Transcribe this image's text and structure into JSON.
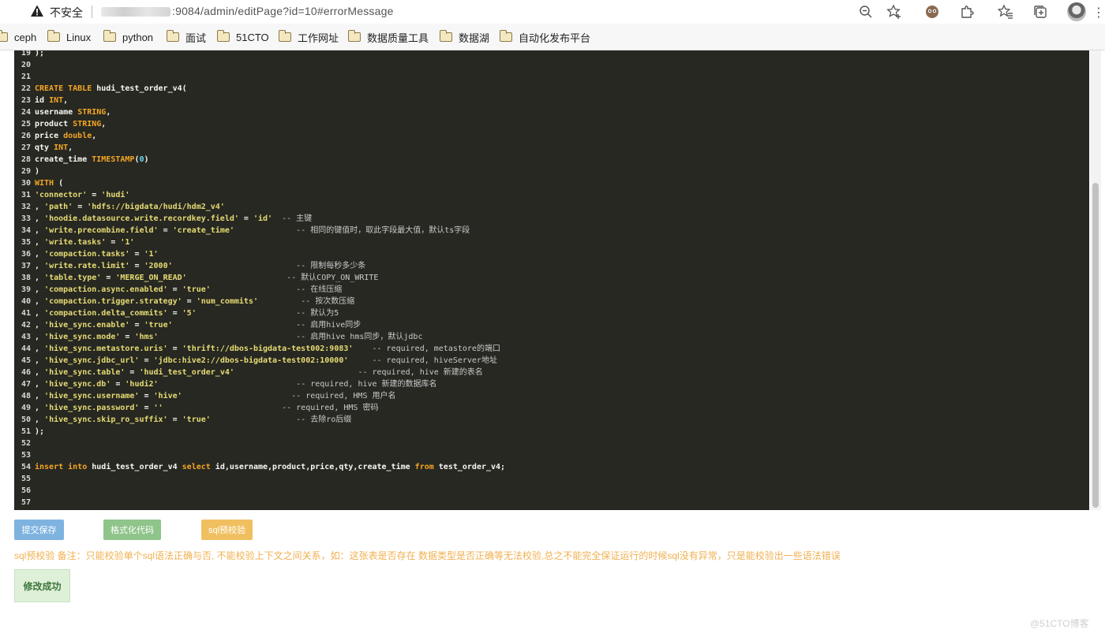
{
  "browser": {
    "security_label": "不安全",
    "url_visible": ":9084/admin/editPage?id=10#errorMessage"
  },
  "bookmarks": [
    "ceph",
    "Linux",
    "python",
    "面试",
    "51CTO",
    "工作网址",
    "数据质量工具",
    "数据湖",
    "自动化发布平台"
  ],
  "editor": {
    "lines": [
      {
        "n": "19",
        "segs": [
          [
            "t",
            ");"
          ]
        ]
      },
      {
        "n": "20",
        "segs": []
      },
      {
        "n": "21",
        "segs": []
      },
      {
        "n": "22",
        "segs": [
          [
            "k",
            "CREATE TABLE"
          ],
          [
            "t",
            " hudi_test_order_v4("
          ]
        ]
      },
      {
        "n": "23",
        "segs": [
          [
            "t",
            "id "
          ],
          [
            "k",
            "INT"
          ],
          [
            "t",
            ","
          ]
        ]
      },
      {
        "n": "24",
        "segs": [
          [
            "t",
            "username "
          ],
          [
            "k",
            "STRING"
          ],
          [
            "t",
            ","
          ]
        ]
      },
      {
        "n": "25",
        "segs": [
          [
            "t",
            "product "
          ],
          [
            "k",
            "STRING"
          ],
          [
            "t",
            ","
          ]
        ]
      },
      {
        "n": "26",
        "segs": [
          [
            "t",
            "price "
          ],
          [
            "k",
            "double"
          ],
          [
            "t",
            ","
          ]
        ]
      },
      {
        "n": "27",
        "segs": [
          [
            "t",
            "qty "
          ],
          [
            "k",
            "INT"
          ],
          [
            "t",
            ","
          ]
        ]
      },
      {
        "n": "28",
        "segs": [
          [
            "t",
            "create_time "
          ],
          [
            "k",
            "TIMESTAMP"
          ],
          [
            "t",
            "("
          ],
          [
            "n",
            "0"
          ],
          [
            "t",
            ")"
          ]
        ]
      },
      {
        "n": "29",
        "segs": [
          [
            "t",
            ")"
          ]
        ]
      },
      {
        "n": "30",
        "segs": [
          [
            "k",
            "WITH"
          ],
          [
            "t",
            " ("
          ]
        ]
      },
      {
        "n": "31",
        "segs": [
          [
            "s",
            "'connector'"
          ],
          [
            "t",
            " = "
          ],
          [
            "s",
            "'hudi'"
          ]
        ]
      },
      {
        "n": "32",
        "segs": [
          [
            "t",
            ", "
          ],
          [
            "s",
            "'path'"
          ],
          [
            "t",
            " = "
          ],
          [
            "s",
            "'hdfs://bigdata/hudi/hdm2_v4'"
          ]
        ]
      },
      {
        "n": "33",
        "segs": [
          [
            "t",
            ", "
          ],
          [
            "s",
            "'hoodie.datasource.write.recordkey.field'"
          ],
          [
            "t",
            " = "
          ],
          [
            "s",
            "'id'"
          ],
          [
            "t",
            "  "
          ],
          [
            "c",
            "-- 主键"
          ]
        ]
      },
      {
        "n": "34",
        "segs": [
          [
            "t",
            ", "
          ],
          [
            "s",
            "'write.precombine.field'"
          ],
          [
            "t",
            " = "
          ],
          [
            "s",
            "'create_time'"
          ],
          [
            "t",
            "             "
          ],
          [
            "c",
            "-- 相同的键值时，取此字段最大值，默认ts字段"
          ]
        ]
      },
      {
        "n": "35",
        "segs": [
          [
            "t",
            ", "
          ],
          [
            "s",
            "'write.tasks'"
          ],
          [
            "t",
            " = "
          ],
          [
            "s",
            "'1'"
          ]
        ]
      },
      {
        "n": "36",
        "segs": [
          [
            "t",
            ", "
          ],
          [
            "s",
            "'compaction.tasks'"
          ],
          [
            "t",
            " = "
          ],
          [
            "s",
            "'1'"
          ]
        ]
      },
      {
        "n": "37",
        "segs": [
          [
            "t",
            ", "
          ],
          [
            "s",
            "'write.rate.limit'"
          ],
          [
            "t",
            " = "
          ],
          [
            "s",
            "'2000'"
          ],
          [
            "t",
            "                          "
          ],
          [
            "c",
            "-- 限制每秒多少条"
          ]
        ]
      },
      {
        "n": "38",
        "segs": [
          [
            "t",
            ", "
          ],
          [
            "s",
            "'table.type'"
          ],
          [
            "t",
            " = "
          ],
          [
            "s",
            "'MERGE_ON_READ'"
          ],
          [
            "t",
            "                     "
          ],
          [
            "c",
            "-- 默认COPY_ON_WRITE"
          ]
        ]
      },
      {
        "n": "39",
        "segs": [
          [
            "t",
            ", "
          ],
          [
            "s",
            "'compaction.async.enabled'"
          ],
          [
            "t",
            " = "
          ],
          [
            "s",
            "'true'"
          ],
          [
            "t",
            "                  "
          ],
          [
            "c",
            "-- 在线压缩"
          ]
        ]
      },
      {
        "n": "40",
        "segs": [
          [
            "t",
            ", "
          ],
          [
            "s",
            "'compaction.trigger.strategy'"
          ],
          [
            "t",
            " = "
          ],
          [
            "s",
            "'num_commits'"
          ],
          [
            "t",
            "         "
          ],
          [
            "c",
            "-- 按次数压缩"
          ]
        ]
      },
      {
        "n": "41",
        "segs": [
          [
            "t",
            ", "
          ],
          [
            "s",
            "'compaction.delta_commits'"
          ],
          [
            "t",
            " = "
          ],
          [
            "s",
            "'5'"
          ],
          [
            "t",
            "                     "
          ],
          [
            "c",
            "-- 默认为5"
          ]
        ]
      },
      {
        "n": "42",
        "segs": [
          [
            "t",
            ", "
          ],
          [
            "s",
            "'hive_sync.enable'"
          ],
          [
            "t",
            " = "
          ],
          [
            "s",
            "'true'"
          ],
          [
            "t",
            "                          "
          ],
          [
            "c",
            "-- 启用hive同步"
          ]
        ]
      },
      {
        "n": "43",
        "segs": [
          [
            "t",
            ", "
          ],
          [
            "s",
            "'hive_sync.mode'"
          ],
          [
            "t",
            " = "
          ],
          [
            "s",
            "'hms'"
          ],
          [
            "t",
            "                             "
          ],
          [
            "c",
            "-- 启用hive hms同步，默认jdbc"
          ]
        ]
      },
      {
        "n": "44",
        "segs": [
          [
            "t",
            ", "
          ],
          [
            "s",
            "'hive_sync.metastore.uris'"
          ],
          [
            "t",
            " = "
          ],
          [
            "s",
            "'thrift://dbos-bigdata-test002:9083'"
          ],
          [
            "t",
            "    "
          ],
          [
            "c",
            "-- required, metastore的端口"
          ]
        ]
      },
      {
        "n": "45",
        "segs": [
          [
            "t",
            ", "
          ],
          [
            "s",
            "'hive_sync.jdbc_url'"
          ],
          [
            "t",
            " = "
          ],
          [
            "s",
            "'jdbc:hive2://dbos-bigdata-test002:10000'"
          ],
          [
            "t",
            "     "
          ],
          [
            "c",
            "-- required, hiveServer地址"
          ]
        ]
      },
      {
        "n": "46",
        "segs": [
          [
            "t",
            ", "
          ],
          [
            "s",
            "'hive_sync.table'"
          ],
          [
            "t",
            " = "
          ],
          [
            "s",
            "'hudi_test_order_v4'"
          ],
          [
            "t",
            "                          "
          ],
          [
            "c",
            "-- required, hive 新建的表名"
          ]
        ]
      },
      {
        "n": "47",
        "segs": [
          [
            "t",
            ", "
          ],
          [
            "s",
            "'hive_sync.db'"
          ],
          [
            "t",
            " = "
          ],
          [
            "s",
            "'hudi2'"
          ],
          [
            "t",
            "                             "
          ],
          [
            "c",
            "-- required, hive 新建的数据库名"
          ]
        ]
      },
      {
        "n": "48",
        "segs": [
          [
            "t",
            ", "
          ],
          [
            "s",
            "'hive_sync.username'"
          ],
          [
            "t",
            " = "
          ],
          [
            "s",
            "'hive'"
          ],
          [
            "t",
            "                       "
          ],
          [
            "c",
            "-- required, HMS 用户名"
          ]
        ]
      },
      {
        "n": "49",
        "segs": [
          [
            "t",
            ", "
          ],
          [
            "s",
            "'hive_sync.password'"
          ],
          [
            "t",
            " = "
          ],
          [
            "s",
            "''"
          ],
          [
            "t",
            "                         "
          ],
          [
            "c",
            "-- required, HMS 密码"
          ]
        ]
      },
      {
        "n": "50",
        "segs": [
          [
            "t",
            ", "
          ],
          [
            "s",
            "'hive_sync.skip_ro_suffix'"
          ],
          [
            "t",
            " = "
          ],
          [
            "s",
            "'true'"
          ],
          [
            "t",
            "                  "
          ],
          [
            "c",
            "-- 去除ro后缀"
          ]
        ]
      },
      {
        "n": "51",
        "segs": [
          [
            "t",
            ");"
          ]
        ]
      },
      {
        "n": "52",
        "segs": []
      },
      {
        "n": "53",
        "segs": []
      },
      {
        "n": "54",
        "segs": [
          [
            "k",
            "insert into"
          ],
          [
            "t",
            " hudi_test_order_v4 "
          ],
          [
            "k",
            "select"
          ],
          [
            "t",
            " id,username,product,price,qty,create_time "
          ],
          [
            "k",
            "from"
          ],
          [
            "t",
            " test_order_v4;"
          ]
        ]
      },
      {
        "n": "55",
        "segs": []
      },
      {
        "n": "56",
        "segs": []
      },
      {
        "n": "57",
        "segs": []
      }
    ]
  },
  "buttons": {
    "save": "提交保存",
    "format": "格式化代码",
    "check": "sql预校验"
  },
  "note": "sql预校验 备注：只能校验单个sql语法正确与否, 不能校验上下文之间关系，如：这张表是否存在 数据类型是否正确等无法校验,总之不能完全保证运行的时候sql没有异常，只是能校验出一些语法错误",
  "success_message": "修改成功",
  "watermark": "@51CTO博客"
}
